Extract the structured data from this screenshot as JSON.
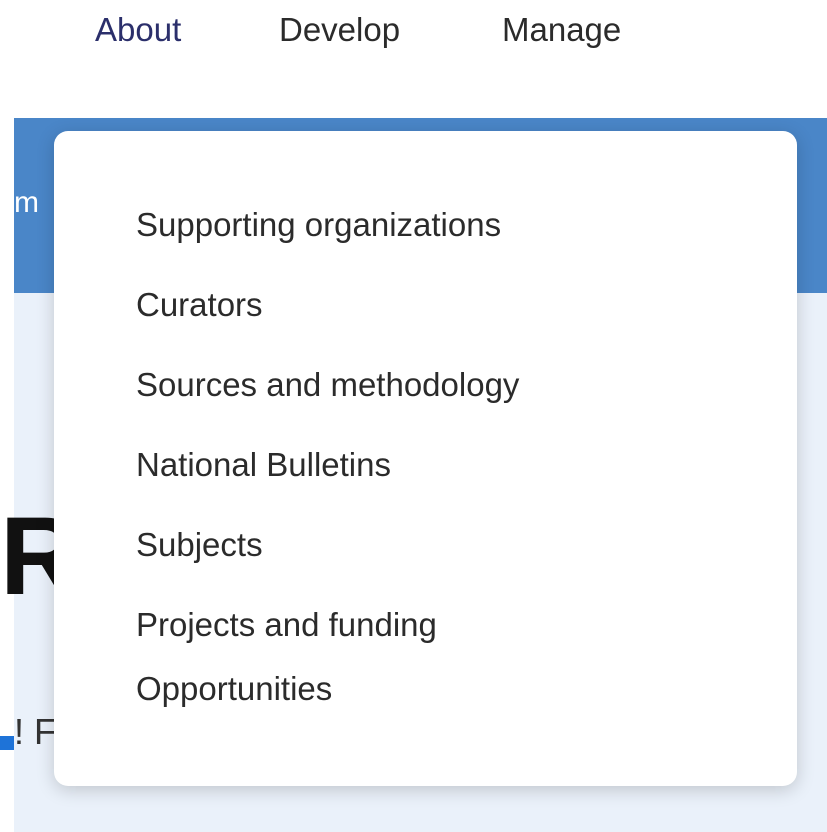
{
  "top_nav": {
    "items": [
      {
        "label": "About",
        "active": true
      },
      {
        "label": "Develop",
        "active": false
      },
      {
        "label": "Manage",
        "active": false
      }
    ]
  },
  "background_fragments": {
    "band_text": "m",
    "heading_fragment": "Re",
    "subline_fragment": "! F"
  },
  "dropdown": {
    "items": [
      {
        "label": "Supporting organizations"
      },
      {
        "label": "Curators"
      },
      {
        "label": "Sources and methodology"
      },
      {
        "label": "National Bulletins"
      },
      {
        "label": "Subjects"
      },
      {
        "label": "Projects and funding"
      },
      {
        "label": "Opportunities"
      }
    ]
  },
  "colors": {
    "band_blue": "#4a86c8",
    "content_bg": "#eaf1fa",
    "active_nav": "#2b2f6b",
    "marker_blue": "#1e73d8"
  }
}
